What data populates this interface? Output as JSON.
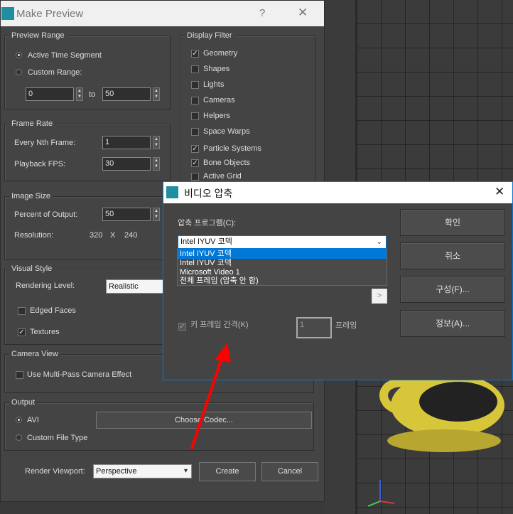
{
  "make_preview": {
    "title": "Make Preview",
    "help_glyph": "?",
    "close_glyph": "✕",
    "preview_range": {
      "title": "Preview Range",
      "active_time_segment": "Active Time Segment",
      "custom_range": "Custom Range:",
      "from_value": "0",
      "to_label": "to",
      "to_value": "50"
    },
    "frame_rate": {
      "title": "Frame Rate",
      "every_nth_label": "Every Nth Frame:",
      "every_nth_value": "1",
      "playback_fps_label": "Playback FPS:",
      "playback_fps_value": "30"
    },
    "image_size": {
      "title": "Image Size",
      "percent_label": "Percent of Output:",
      "percent_value": "50",
      "resolution_label": "Resolution:",
      "res_w": "320",
      "res_x": "X",
      "res_h": "240"
    },
    "visual_style": {
      "title": "Visual Style",
      "rendering_level_label": "Rendering Level:",
      "rendering_level_value": "Realistic",
      "edged_faces": "Edged Faces",
      "textures": "Textures"
    },
    "camera_view": {
      "title": "Camera View",
      "multi_pass": "Use Multi-Pass Camera Effect"
    },
    "output": {
      "title": "Output",
      "avi": "AVI",
      "custom_file_type": "Custom File Type",
      "choose_codec": "Choose Codec..."
    },
    "bottom": {
      "render_viewport_label": "Render Viewport:",
      "render_viewport_value": "Perspective",
      "create": "Create",
      "cancel": "Cancel"
    },
    "display_filter": {
      "title": "Display Filter",
      "items": [
        {
          "label": "Geometry",
          "checked": true
        },
        {
          "label": "Shapes",
          "checked": false
        },
        {
          "label": "Lights",
          "checked": false
        },
        {
          "label": "Cameras",
          "checked": false
        },
        {
          "label": "Helpers",
          "checked": false
        },
        {
          "label": "Space Warps",
          "checked": false
        },
        {
          "label": "Particle Systems",
          "checked": true
        },
        {
          "label": "Bone Objects",
          "checked": true
        },
        {
          "label": "Active Grid",
          "checked": false
        }
      ]
    }
  },
  "video_dialog": {
    "title": "비디오 압축",
    "close_glyph": "✕",
    "compressor_label": "압축 프로그램(C):",
    "combo_value": "Intel IYUV 코덱",
    "options": [
      "Intel IYUV 코덱",
      "Intel IYUV 코덱",
      "Microsoft Video 1",
      "전체 프레임 (압축 안 함)"
    ],
    "keyframe_label": "키 프레임 간격(K)",
    "keyframe_value": "1",
    "frame_unit": "프레임",
    "buttons": {
      "ok": "확인",
      "cancel": "취소",
      "configure": "구성(F)...",
      "about": "정보(A)..."
    }
  },
  "colors": {
    "panel_bg": "#444444",
    "accent": "#0078d7",
    "arrow": "#ff0000",
    "teapot": "#d8c63a"
  }
}
